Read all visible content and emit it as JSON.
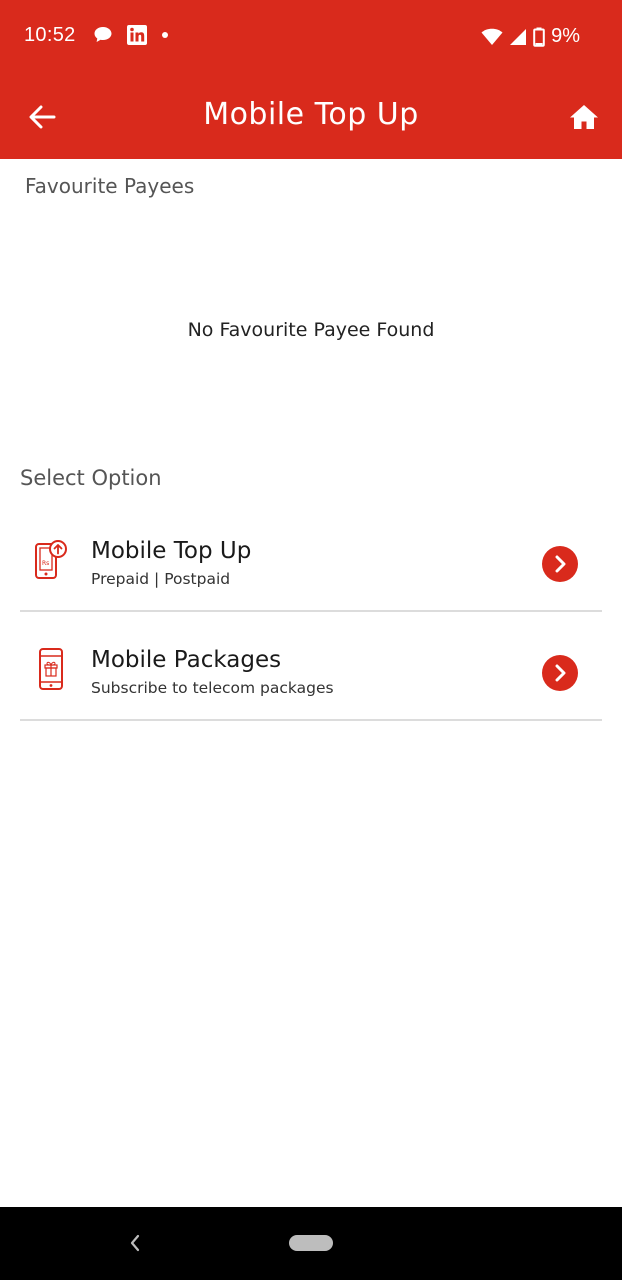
{
  "status_bar": {
    "time": "10:52",
    "battery": "9%",
    "icons": [
      "chat-bubble-icon",
      "linkedin-icon",
      "dot-icon",
      "wifi-icon",
      "signal-icon",
      "battery-icon"
    ]
  },
  "app_bar": {
    "title": "Mobile Top Up",
    "back_icon": "arrow-left-icon",
    "home_icon": "home-icon"
  },
  "favourites": {
    "label": "Favourite Payees",
    "empty_message": "No Favourite Payee Found"
  },
  "options": {
    "label": "Select Option",
    "items": [
      {
        "title": "Mobile Top Up",
        "subtitle": "Prepaid | Postpaid",
        "icon": "phone-topup-icon"
      },
      {
        "title": "Mobile Packages",
        "subtitle": "Subscribe to telecom packages",
        "icon": "phone-gift-icon"
      }
    ]
  },
  "colors": {
    "brand_red": "#d92a1c",
    "divider": "#dcdcdc"
  }
}
